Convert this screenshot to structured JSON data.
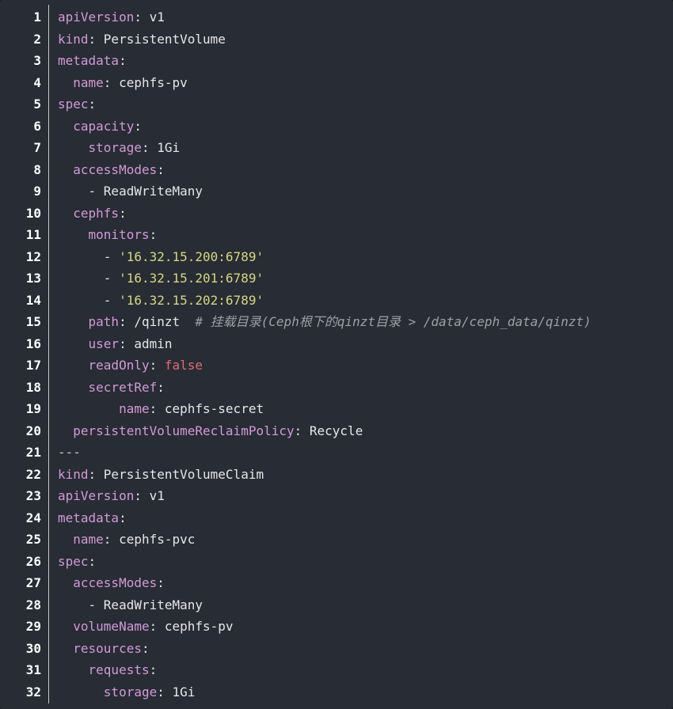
{
  "theme": {
    "background": "#282c34",
    "key_color": "#d19ad9",
    "value_color": "#e6e6e6",
    "string_color": "#d7d782",
    "comment_color": "#9ca0a6",
    "boolean_color": "#e06c75"
  },
  "lines": [
    {
      "num": "1",
      "indent": "",
      "tokens": [
        {
          "t": "apiVersion",
          "c": "k"
        },
        {
          "t": ": ",
          "c": "p"
        },
        {
          "t": "v1",
          "c": "v"
        }
      ]
    },
    {
      "num": "2",
      "indent": "",
      "tokens": [
        {
          "t": "kind",
          "c": "k"
        },
        {
          "t": ": ",
          "c": "p"
        },
        {
          "t": "PersistentVolume",
          "c": "v"
        }
      ]
    },
    {
      "num": "3",
      "indent": "",
      "tokens": [
        {
          "t": "metadata",
          "c": "k"
        },
        {
          "t": ":",
          "c": "p"
        }
      ]
    },
    {
      "num": "4",
      "indent": "  ",
      "tokens": [
        {
          "t": "name",
          "c": "k"
        },
        {
          "t": ": ",
          "c": "p"
        },
        {
          "t": "cephfs-pv",
          "c": "v"
        }
      ]
    },
    {
      "num": "5",
      "indent": "",
      "tokens": [
        {
          "t": "spec",
          "c": "k"
        },
        {
          "t": ":",
          "c": "p"
        }
      ]
    },
    {
      "num": "6",
      "indent": "  ",
      "tokens": [
        {
          "t": "capacity",
          "c": "k"
        },
        {
          "t": ":",
          "c": "p"
        }
      ]
    },
    {
      "num": "7",
      "indent": "    ",
      "tokens": [
        {
          "t": "storage",
          "c": "k"
        },
        {
          "t": ": ",
          "c": "p"
        },
        {
          "t": "1Gi",
          "c": "v"
        }
      ]
    },
    {
      "num": "8",
      "indent": "  ",
      "tokens": [
        {
          "t": "accessModes",
          "c": "k"
        },
        {
          "t": ":",
          "c": "p"
        }
      ]
    },
    {
      "num": "9",
      "indent": "    ",
      "tokens": [
        {
          "t": "- ",
          "c": "p"
        },
        {
          "t": "ReadWriteMany",
          "c": "v"
        }
      ]
    },
    {
      "num": "10",
      "indent": "  ",
      "tokens": [
        {
          "t": "cephfs",
          "c": "k"
        },
        {
          "t": ":",
          "c": "p"
        }
      ]
    },
    {
      "num": "11",
      "indent": "    ",
      "tokens": [
        {
          "t": "monitors",
          "c": "k"
        },
        {
          "t": ":",
          "c": "p"
        }
      ]
    },
    {
      "num": "12",
      "indent": "      ",
      "tokens": [
        {
          "t": "- ",
          "c": "p"
        },
        {
          "t": "'16.32.15.200:6789'",
          "c": "s"
        }
      ]
    },
    {
      "num": "13",
      "indent": "      ",
      "tokens": [
        {
          "t": "- ",
          "c": "p"
        },
        {
          "t": "'16.32.15.201:6789'",
          "c": "s"
        }
      ]
    },
    {
      "num": "14",
      "indent": "      ",
      "tokens": [
        {
          "t": "- ",
          "c": "p"
        },
        {
          "t": "'16.32.15.202:6789'",
          "c": "s"
        }
      ]
    },
    {
      "num": "15",
      "indent": "    ",
      "tokens": [
        {
          "t": "path",
          "c": "k"
        },
        {
          "t": ": ",
          "c": "p"
        },
        {
          "t": "/qinzt  ",
          "c": "v"
        },
        {
          "t": "# 挂载目录(Ceph根下的qinzt目录 > /data/ceph_data/qinzt)",
          "c": "c"
        }
      ]
    },
    {
      "num": "16",
      "indent": "    ",
      "tokens": [
        {
          "t": "user",
          "c": "k"
        },
        {
          "t": ": ",
          "c": "p"
        },
        {
          "t": "admin",
          "c": "v"
        }
      ]
    },
    {
      "num": "17",
      "indent": "    ",
      "tokens": [
        {
          "t": "readOnly",
          "c": "k"
        },
        {
          "t": ": ",
          "c": "p"
        },
        {
          "t": "false",
          "c": "b"
        }
      ]
    },
    {
      "num": "18",
      "indent": "    ",
      "tokens": [
        {
          "t": "secretRef",
          "c": "k"
        },
        {
          "t": ":",
          "c": "p"
        }
      ]
    },
    {
      "num": "19",
      "indent": "        ",
      "tokens": [
        {
          "t": "name",
          "c": "k"
        },
        {
          "t": ": ",
          "c": "p"
        },
        {
          "t": "cephfs-secret",
          "c": "v"
        }
      ]
    },
    {
      "num": "20",
      "indent": "  ",
      "tokens": [
        {
          "t": "persistentVolumeReclaimPolicy",
          "c": "k"
        },
        {
          "t": ": ",
          "c": "p"
        },
        {
          "t": "Recycle",
          "c": "v"
        }
      ]
    },
    {
      "num": "21",
      "indent": "",
      "tokens": [
        {
          "t": "---",
          "c": "d"
        }
      ]
    },
    {
      "num": "22",
      "indent": "",
      "tokens": [
        {
          "t": "kind",
          "c": "k"
        },
        {
          "t": ": ",
          "c": "p"
        },
        {
          "t": "PersistentVolumeClaim",
          "c": "v"
        }
      ]
    },
    {
      "num": "23",
      "indent": "",
      "tokens": [
        {
          "t": "apiVersion",
          "c": "k"
        },
        {
          "t": ": ",
          "c": "p"
        },
        {
          "t": "v1",
          "c": "v"
        }
      ]
    },
    {
      "num": "24",
      "indent": "",
      "tokens": [
        {
          "t": "metadata",
          "c": "k"
        },
        {
          "t": ":",
          "c": "p"
        }
      ]
    },
    {
      "num": "25",
      "indent": "  ",
      "tokens": [
        {
          "t": "name",
          "c": "k"
        },
        {
          "t": ": ",
          "c": "p"
        },
        {
          "t": "cephfs-pvc",
          "c": "v"
        }
      ]
    },
    {
      "num": "26",
      "indent": "",
      "tokens": [
        {
          "t": "spec",
          "c": "k"
        },
        {
          "t": ":",
          "c": "p"
        }
      ]
    },
    {
      "num": "27",
      "indent": "  ",
      "tokens": [
        {
          "t": "accessModes",
          "c": "k"
        },
        {
          "t": ":",
          "c": "p"
        }
      ]
    },
    {
      "num": "28",
      "indent": "    ",
      "tokens": [
        {
          "t": "- ",
          "c": "p"
        },
        {
          "t": "ReadWriteMany",
          "c": "v"
        }
      ]
    },
    {
      "num": "29",
      "indent": "  ",
      "tokens": [
        {
          "t": "volumeName",
          "c": "k"
        },
        {
          "t": ": ",
          "c": "p"
        },
        {
          "t": "cephfs-pv",
          "c": "v"
        }
      ]
    },
    {
      "num": "30",
      "indent": "  ",
      "tokens": [
        {
          "t": "resources",
          "c": "k"
        },
        {
          "t": ":",
          "c": "p"
        }
      ]
    },
    {
      "num": "31",
      "indent": "    ",
      "tokens": [
        {
          "t": "requests",
          "c": "k"
        },
        {
          "t": ":",
          "c": "p"
        }
      ]
    },
    {
      "num": "32",
      "indent": "      ",
      "tokens": [
        {
          "t": "storage",
          "c": "k"
        },
        {
          "t": ": ",
          "c": "p"
        },
        {
          "t": "1Gi",
          "c": "v"
        }
      ]
    }
  ]
}
